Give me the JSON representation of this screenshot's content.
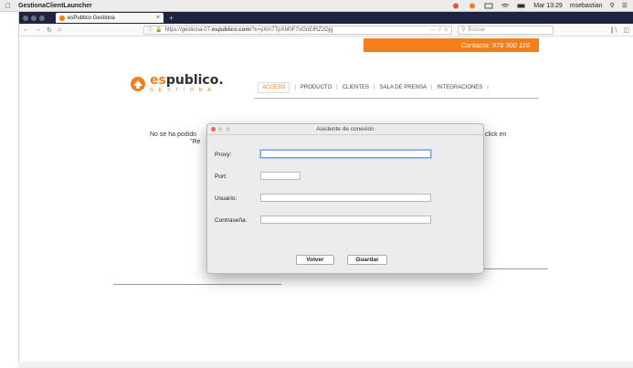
{
  "menubar": {
    "app_name": "GestionaClientLauncher",
    "datetime": "Mar 13:29",
    "user": "msebastian"
  },
  "browser": {
    "tab_title": "esPublico Gestiona",
    "url_prefix": "https://gestiona-07.",
    "url_domain": "espublico.com",
    "url_path": "/?x=yXm7TpXM0F7oGnEIRZ2Gjg",
    "search_placeholder": "Buscar"
  },
  "page": {
    "contact": "Contacta: 976 300 110",
    "logo_prefix": "es",
    "logo_main": "publico.",
    "logo_sub": "GESTIONA",
    "nav": [
      "ACCESO",
      "PRODUCTO",
      "CLIENTES",
      "SALA DE PRENSA",
      "INTEGRACIONES"
    ],
    "message_left": "No se ha podido",
    "message_left2": "\"Re",
    "message_right": "click en"
  },
  "dialog": {
    "title": "Asistente de conexión",
    "labels": {
      "proxy": "Proxy:",
      "port": "Port:",
      "user": "Usuario:",
      "password": "Contraseña:"
    },
    "values": {
      "proxy": "",
      "port": "",
      "user": "",
      "password": ""
    },
    "buttons": {
      "back": "Volver",
      "save": "Guardar"
    }
  },
  "colors": {
    "accent": "#f37f1c",
    "tabbar": "#202340"
  }
}
